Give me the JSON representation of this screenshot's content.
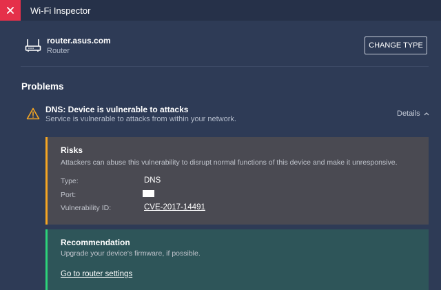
{
  "window": {
    "title": "Wi-Fi Inspector"
  },
  "device": {
    "name": "router.asus.com",
    "type": "Router",
    "change_type_label": "CHANGE TYPE"
  },
  "problems": {
    "heading": "Problems",
    "item": {
      "title": "DNS: Device is vulnerable to attacks",
      "description": "Service is vulnerable to attacks from within your network.",
      "details_label": "Details"
    }
  },
  "risks": {
    "title": "Risks",
    "text": "Attackers can abuse this vulnerability to disrupt normal functions of this device and make it unresponsive.",
    "type_label": "Type:",
    "type_value": "DNS",
    "port_label": "Port:",
    "vuln_label": "Vulnerability ID:",
    "vuln_value": "CVE-2017-14491"
  },
  "recommendation": {
    "title": "Recommendation",
    "text": "Upgrade your device's firmware, if possible.",
    "link_label": "Go to router settings"
  },
  "colors": {
    "background": "#2e3b56",
    "close_button": "#e5304a",
    "risk_accent": "#f5a623",
    "recommendation_accent": "#2dd27a"
  },
  "icons": [
    "close-icon",
    "router-icon",
    "warning-icon",
    "chevron-up-icon"
  ]
}
